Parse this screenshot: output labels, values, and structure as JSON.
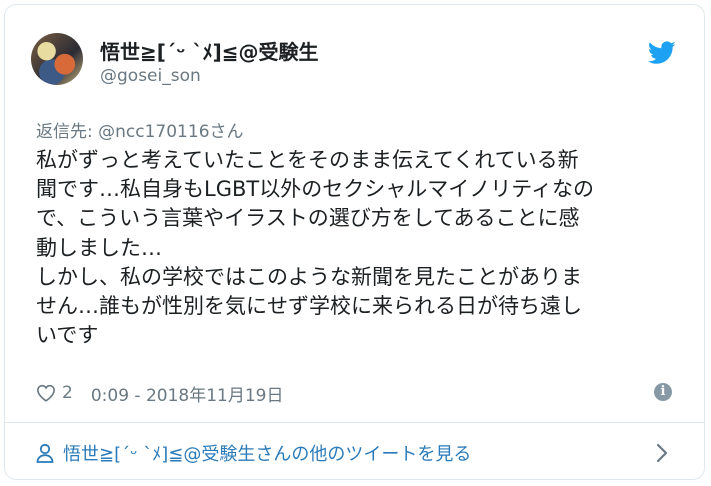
{
  "author": {
    "display_name": "悟世≧[´ᵕ `ﾒ]≦@受験生",
    "handle": "@gosei_son"
  },
  "reply": {
    "prefix": "返信先: ",
    "mention": "@ncc170116さん"
  },
  "tweet": {
    "lines": [
      "私がずっと考えていたことをそのまま伝えてくれている新",
      "聞です…私自身もLGBT以外のセクシャルマイノリティなの",
      "で、こういう言葉やイラストの選び方をしてあることに感",
      "動しました…",
      "しかし、私の学校ではこのような新聞を見たことがありま",
      "せん…誰もが性別を気にせず学校に来られる日が待ち遠し",
      "いです"
    ]
  },
  "meta": {
    "like_count": "2",
    "timestamp": "0:09 - 2018年11月19日"
  },
  "footer": {
    "link_text": "悟世≧[´ᵕ `ﾒ]≦@受験生さんの他のツイートを見る"
  },
  "colors": {
    "twitter_blue": "#1da1f2",
    "link_blue": "#2b7bb9",
    "secondary_text": "#697882"
  },
  "icons": [
    "twitter-bird-icon",
    "heart-icon",
    "info-icon",
    "person-icon",
    "chevron-right-icon"
  ]
}
